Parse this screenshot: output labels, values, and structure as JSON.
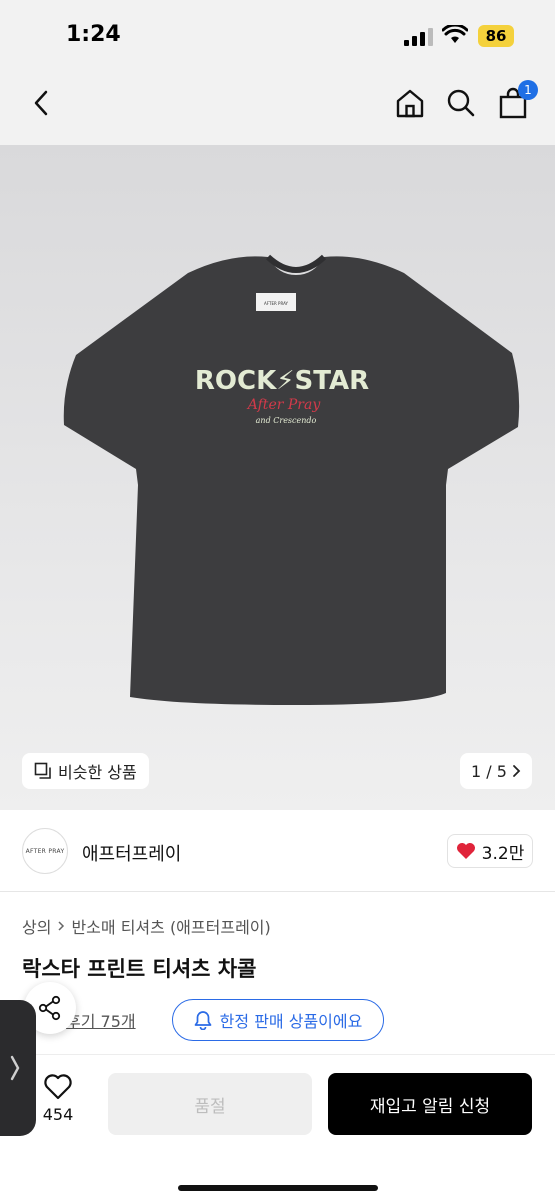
{
  "status_bar": {
    "time": "1:24",
    "battery": "86"
  },
  "nav": {
    "cart_count": "1"
  },
  "product_image": {
    "shirt_print": {
      "line1": "ROCK⚡STAR",
      "line2": "After Pray",
      "line3": "and Crescendo"
    },
    "neck_label": "AFTER PRAY",
    "similar_label": "비슷한 상품",
    "page_indicator": "1 / 5"
  },
  "brand": {
    "logo_text": "AFTER PRAY",
    "name": "애프터프레이",
    "likes": "3.2만"
  },
  "breadcrumb": {
    "level1": "상의",
    "level2": "반소매 티셔츠 (애프터프레이)"
  },
  "product": {
    "title": "락스타 프린트 티셔츠 차콜",
    "review_label": "후기 75개",
    "limited_label": "한정 판매 상품이에요"
  },
  "bottom_bar": {
    "wish_count": "454",
    "soldout_label": "품절",
    "restock_label": "재입고 알림 신청"
  },
  "colors": {
    "accent_blue": "#2b6be6",
    "heart_red": "#e0243a",
    "shirt_charcoal": "#3d3d3f",
    "battery_yellow": "#f4d13c"
  }
}
